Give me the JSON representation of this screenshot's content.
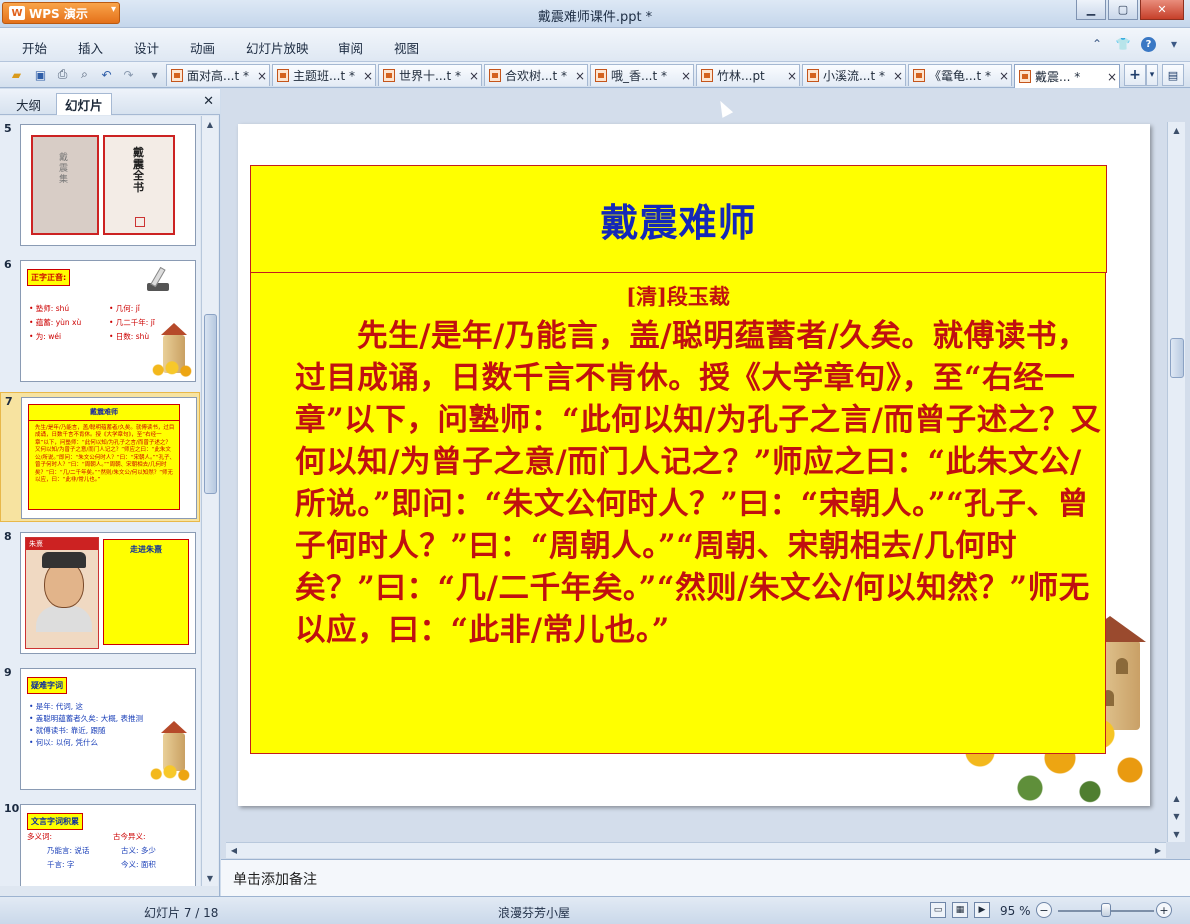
{
  "app": {
    "name": "WPS 演示",
    "window_title": "戴震难师课件.ppt *"
  },
  "menu": [
    "开始",
    "插入",
    "设计",
    "动画",
    "幻灯片放映",
    "审阅",
    "视图"
  ],
  "doc_tabs": [
    {
      "label": "面对高...t *"
    },
    {
      "label": "主题班...t *"
    },
    {
      "label": "世界十...t *"
    },
    {
      "label": "合欢树...t *"
    },
    {
      "label": "哦_香...t *"
    },
    {
      "label": "竹林...pt"
    },
    {
      "label": "小溪流...t *"
    },
    {
      "label": "《鼋龟...t *"
    },
    {
      "label": "戴震... *"
    }
  ],
  "left_panel": {
    "tabs": [
      "大纲",
      "幻灯片"
    ],
    "active_tab": "幻灯片",
    "slides": [
      {
        "num": "5",
        "title": "戴震全书",
        "spine": "戴震集"
      },
      {
        "num": "6",
        "title": "正字正音:",
        "lines": [
          "• 塾师: shú",
          "• 蕴蓄: yùn xù",
          "• 为: wéi",
          "• 几何: jǐ",
          "• 几二千年: jī",
          "• 日数: shù"
        ]
      },
      {
        "num": "7",
        "title": "戴震难师",
        "selected": true
      },
      {
        "num": "8",
        "title": "走进朱熹",
        "portrait_label": "朱熹"
      },
      {
        "num": "9",
        "title": "疑难字词",
        "lines": [
          "• 是年: 代词, 这",
          "• 盖聪明蕴蓄者久矣: 大概, 表推测",
          "• 就傅读书: 靠近, 跟随",
          "• 何以: 以何, 凭什么"
        ]
      },
      {
        "num": "10",
        "title": "文言字词积累",
        "lines": [
          "多义词:",
          "古今异义:",
          "乃能言: 说话",
          "千言: 字",
          "古义: 多少",
          "今义: 面积"
        ]
      }
    ]
  },
  "slide": {
    "title": "戴震难师",
    "author": "[清]段玉裁",
    "body": "先生/是年/乃能言，盖/聪明蕴蓄者/久矣。就傅读书，过目成诵，日数千言不肯休。授《大学章句》，至“右经一章”以下，问塾师：“此何以知/为孔子之言/而曾子述之？又何以知/为曾子之意/而门人记之？”师应之曰：“此朱文公/所说。”即问：“朱文公何时人？”曰：“宋朝人。”“孔子、曾子何时人？”曰：“周朝人。”“周朝、宋朝相去/几何时矣？”曰：“几/二千年矣。”“然则/朱文公/何以知然？”师无以应，曰：“此非/常儿也。”"
  },
  "notes": {
    "placeholder": "单击添加备注"
  },
  "status": {
    "slide_indicator": "幻灯片 7 / 18",
    "theme": "浪漫芬芳小屋",
    "zoom": "95 %",
    "zoom_level": 0.5
  },
  "colors": {
    "title_blue": "#1428b8",
    "body_red": "#c01010",
    "slide_fill": "#ffff00",
    "wps_orange": "#e4711a"
  }
}
